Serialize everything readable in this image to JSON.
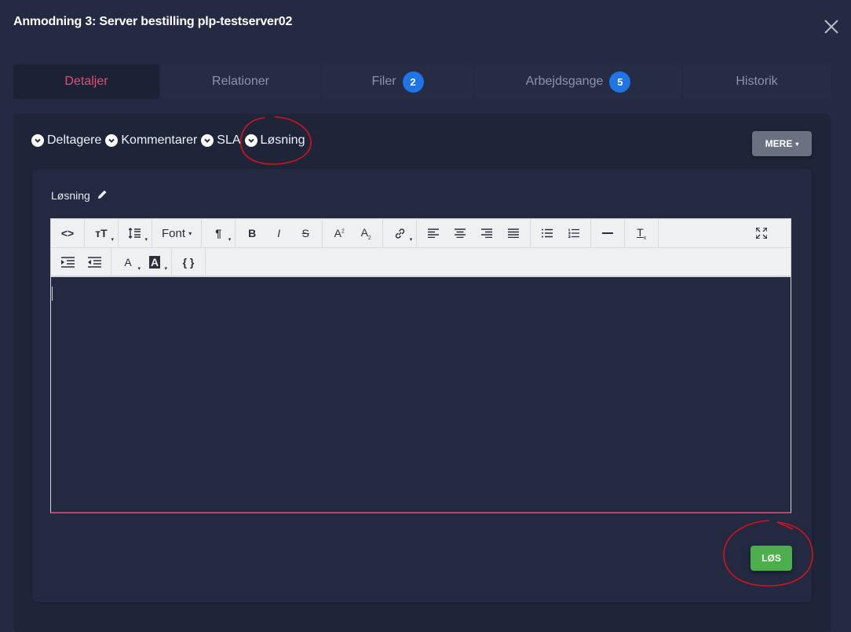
{
  "modal": {
    "title": "Anmodning 3: Server bestilling plp-testserver02"
  },
  "tabs": [
    {
      "label": "Detaljer",
      "badge": null,
      "active": true
    },
    {
      "label": "Relationer",
      "badge": null
    },
    {
      "label": "Filer",
      "badge": "2"
    },
    {
      "label": "Arbejdsgange",
      "badge": "5"
    },
    {
      "label": "Historik",
      "badge": null
    }
  ],
  "sections": [
    {
      "label": "Deltagere"
    },
    {
      "label": "Kommentarer"
    },
    {
      "label": "SLA"
    },
    {
      "label": "Løsning"
    }
  ],
  "mere_button": {
    "label": "MERE"
  },
  "editor": {
    "label": "Løsning",
    "font_dropdown_label": "Font",
    "code_view_label": "<>",
    "var_label": "{ }"
  },
  "los_button": {
    "label": "LØS"
  },
  "colors": {
    "background": "#232a41",
    "active_tab": "#e94a79",
    "badge": "#1f74e6",
    "los_button": "#4cae4c",
    "annotation": "#d6121c"
  }
}
